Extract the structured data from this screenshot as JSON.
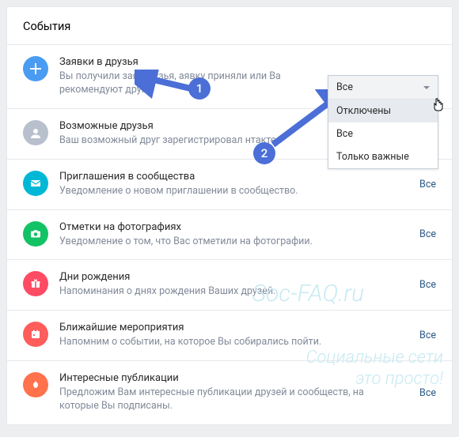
{
  "header": "События",
  "rows": [
    {
      "icon": "plus-icon",
      "bg": "blue",
      "title": "Заявки в друзья",
      "desc_prefix": "Вы получили заявку",
      "desc_suffix": "узья,           аявку приняли или Ва",
      "desc_line2": "рекомендуют друга.",
      "control": "dropdown"
    },
    {
      "icon": "person-icon",
      "bg": "grey",
      "title": "Возможные друзья",
      "desc": "Ваш возможный друг зарегистрировал            нтакте.",
      "control": ""
    },
    {
      "icon": "mail-icon",
      "bg": "cyan",
      "title": "Приглашения в сообщества",
      "desc": "Уведомление о новом приглашении в сообщество.",
      "control": "Все"
    },
    {
      "icon": "camera-icon",
      "bg": "green",
      "title": "Отметки на фотографиях",
      "desc": "Уведомление о том, что Вас отметили на фотографии.",
      "control": "Все"
    },
    {
      "icon": "gift-icon",
      "bg": "red",
      "title": "Дни рождения",
      "desc": "Напоминания о днях рождения Ваших друзей.",
      "control": "Все"
    },
    {
      "icon": "calendar-icon",
      "bg": "red2",
      "title": "Ближайшие мероприятия",
      "desc": "Напомним о событии, на которое Вы собирались пойти.",
      "control": "Все"
    },
    {
      "icon": "fire-icon",
      "bg": "orange",
      "title": "Интересные публикации",
      "desc": "Предложим Вам интересные публикации друзей и сообществ, на которые Вы подписаны.",
      "control": "Все"
    }
  ],
  "dropdown": {
    "selected": "Все",
    "options": [
      "Отключены",
      "Все",
      "Только важные"
    ]
  },
  "annotations": {
    "n1": "1",
    "n2": "2"
  },
  "watermark": {
    "line1": "Soc-FAQ.ru",
    "line2": "Социальные сети",
    "line3": "это просто!"
  }
}
